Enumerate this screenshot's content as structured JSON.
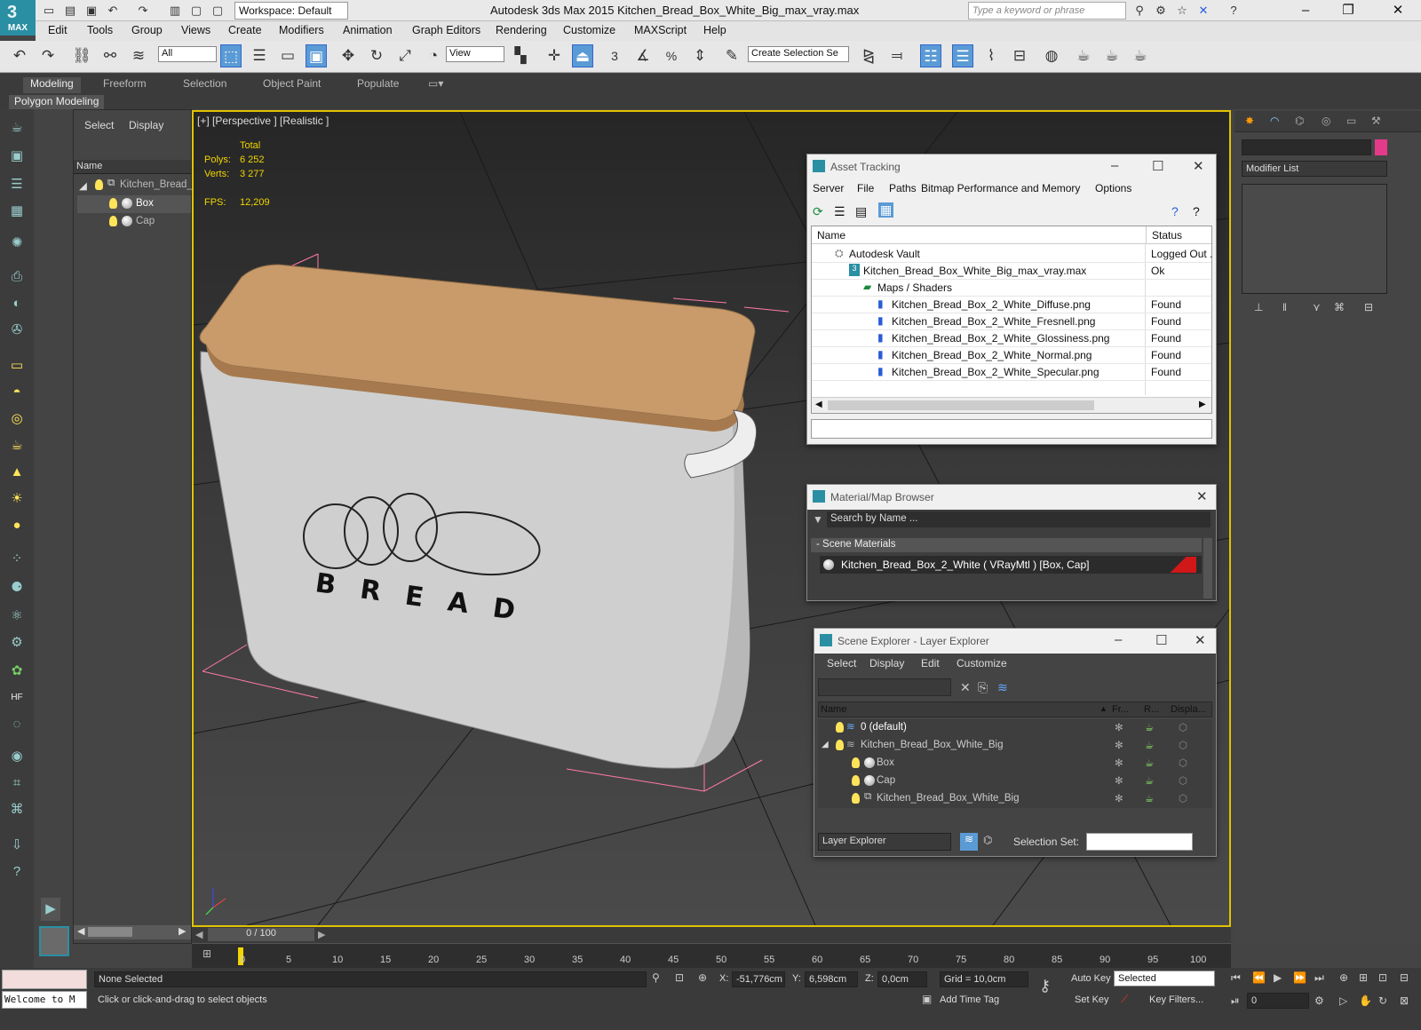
{
  "app": {
    "logo_label": "MAX",
    "window_title": "Autodesk 3ds Max  2015    Kitchen_Bread_Box_White_Big_max_vray.max",
    "workspace": "Workspace: Default",
    "search_placeholder": "Type a keyword or phrase"
  },
  "menubar": [
    "Edit",
    "Tools",
    "Group",
    "Views",
    "Create",
    "Modifiers",
    "Animation",
    "Graph Editors",
    "Rendering",
    "Customize",
    "MAXScript",
    "Help"
  ],
  "toolbar": {
    "filter": "All",
    "refcoord": "View",
    "selection_set": "Create Selection Se",
    "snap_labels": [
      "3",
      "%"
    ]
  },
  "ribbon": {
    "tabs": [
      "Modeling",
      "Freeform",
      "Selection",
      "Object Paint",
      "Populate"
    ],
    "panel": "Polygon Modeling"
  },
  "scene_panel": {
    "tabs": [
      "Select",
      "Display"
    ],
    "column": "Name",
    "items": [
      "Kitchen_Bread_",
      "Box",
      "Cap"
    ]
  },
  "viewport": {
    "label": "[+] [Perspective ] [Realistic ]",
    "stats_header": "Total",
    "polys_label": "Polys:",
    "polys": "6 252",
    "verts_label": "Verts:",
    "verts": "3 277",
    "fps_label": "FPS:",
    "fps": "12,209",
    "model_text": "BREAD"
  },
  "asset_tracking": {
    "title": "Asset Tracking",
    "menu": [
      "Server",
      "File",
      "Paths",
      "Bitmap Performance and Memory",
      "Options"
    ],
    "columns": [
      "Name",
      "Status"
    ],
    "rows": [
      {
        "name": "Autodesk Vault",
        "status": "Logged Out ."
      },
      {
        "name": "Kitchen_Bread_Box_White_Big_max_vray.max",
        "status": "Ok"
      },
      {
        "name": "Maps / Shaders",
        "status": ""
      },
      {
        "name": "Kitchen_Bread_Box_2_White_Diffuse.png",
        "status": "Found"
      },
      {
        "name": "Kitchen_Bread_Box_2_White_Fresnell.png",
        "status": "Found"
      },
      {
        "name": "Kitchen_Bread_Box_2_White_Glossiness.png",
        "status": "Found"
      },
      {
        "name": "Kitchen_Bread_Box_2_White_Normal.png",
        "status": "Found"
      },
      {
        "name": "Kitchen_Bread_Box_2_White_Specular.png",
        "status": "Found"
      }
    ]
  },
  "material_browser": {
    "title": "Material/Map Browser",
    "search_placeholder": "Search by Name ...",
    "section": "- Scene Materials",
    "material": "Kitchen_Bread_Box_2_White  ( VRayMtl ) [Box, Cap]"
  },
  "scene_explorer": {
    "title": "Scene Explorer - Layer Explorer",
    "menu": [
      "Select",
      "Display",
      "Edit",
      "Customize"
    ],
    "columns": [
      "Name",
      "Fr...",
      "R...",
      "Displa..."
    ],
    "rows": [
      "0 (default)",
      "Kitchen_Bread_Box_White_Big",
      "Box",
      "Cap",
      "Kitchen_Bread_Box_White_Big"
    ],
    "footer_mode": "Layer Explorer",
    "selection_set_label": "Selection Set:"
  },
  "command_panel": {
    "modifier_list": "Modifier List"
  },
  "timeline": {
    "frame": "0 / 100",
    "ticks": [
      "0",
      "5",
      "10",
      "15",
      "20",
      "25",
      "30",
      "35",
      "40",
      "45",
      "50",
      "55",
      "60",
      "65",
      "70",
      "75",
      "80",
      "85",
      "90",
      "95",
      "100"
    ]
  },
  "status": {
    "maxscript": "Welcome to M",
    "selection": "None Selected",
    "prompt": "Click or click-and-drag to select objects",
    "x_label": "X:",
    "x": "-51,776cm",
    "y_label": "Y:",
    "y": "6,598cm",
    "z_label": "Z:",
    "z": "0,0cm",
    "grid": "Grid = 10,0cm",
    "auto_key": "Auto Key",
    "key_mode": "Selected",
    "set_key": "Set Key",
    "key_filters": "Key Filters...",
    "add_time_tag": "Add Time Tag",
    "frame_field": "0"
  }
}
